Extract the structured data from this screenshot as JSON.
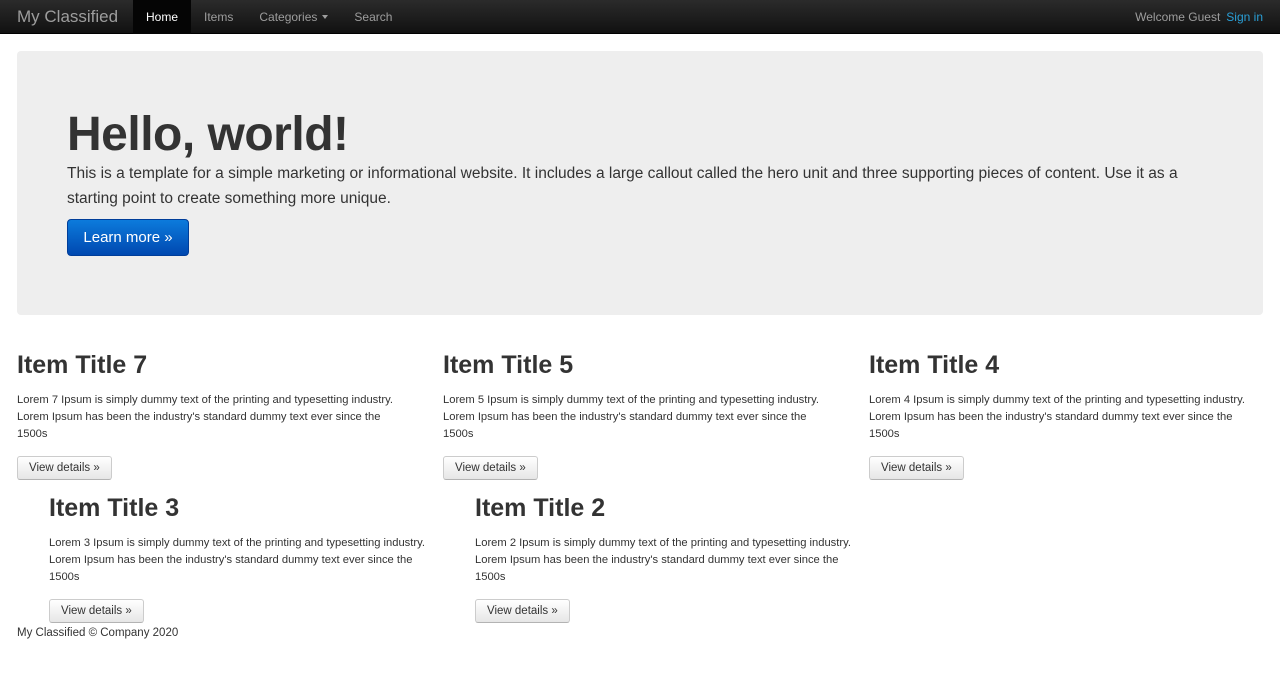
{
  "navbar": {
    "brand": "My Classified",
    "items": [
      {
        "label": "Home"
      },
      {
        "label": "Items"
      },
      {
        "label": "Categories"
      },
      {
        "label": "Search"
      }
    ],
    "welcome": "Welcome Guest",
    "signin": "Sign in"
  },
  "hero": {
    "title": "Hello, world!",
    "text": "This is a template for a simple marketing or informational website. It includes a large callout called the hero unit and three supporting pieces of content. Use it as a starting point to create something more unique.",
    "button": "Learn more »"
  },
  "items": [
    {
      "title": "Item Title 7",
      "text": "Lorem 7 Ipsum is simply dummy text of the printing and typesetting industry. Lorem Ipsum has been the industry's standard dummy text ever since the 1500s",
      "button": "View details »"
    },
    {
      "title": "Item Title 5",
      "text": "Lorem 5 Ipsum is simply dummy text of the printing and typesetting industry. Lorem Ipsum has been the industry's standard dummy text ever since the 1500s",
      "button": "View details »"
    },
    {
      "title": "Item Title 4",
      "text": "Lorem 4 Ipsum is simply dummy text of the printing and typesetting industry. Lorem Ipsum has been the industry's standard dummy text ever since the 1500s",
      "button": "View details »"
    },
    {
      "title": "Item Title 3",
      "text": "Lorem 3 Ipsum is simply dummy text of the printing and typesetting industry. Lorem Ipsum has been the industry's standard dummy text ever since the 1500s",
      "button": "View details »"
    },
    {
      "title": "Item Title 2",
      "text": "Lorem 2 Ipsum is simply dummy text of the printing and typesetting industry. Lorem Ipsum has been the industry's standard dummy text ever since the 1500s",
      "button": "View details »"
    }
  ],
  "footer": "My Classified © Company 2020"
}
